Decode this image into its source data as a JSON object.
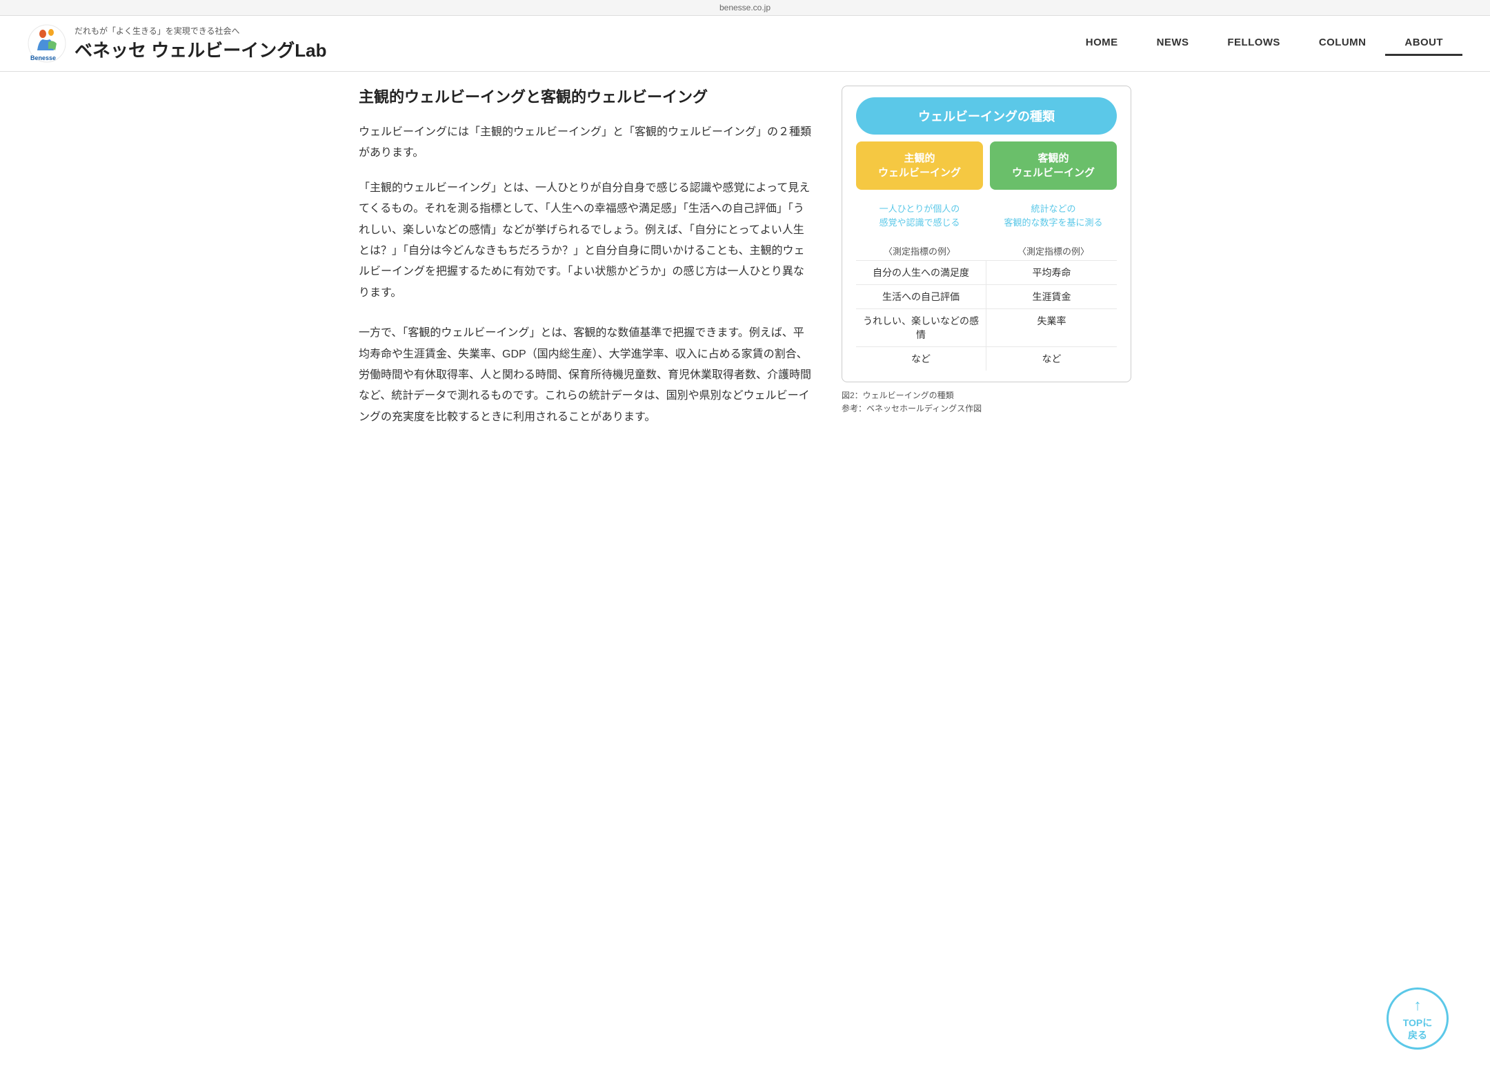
{
  "topbar": {
    "url": "benesse.co.jp"
  },
  "header": {
    "tagline": "だれもが「よく生きる」を実現できる社会へ",
    "title": "ベネッセ ウェルビーイングLab",
    "nav": [
      {
        "label": "HOME",
        "active": false
      },
      {
        "label": "NEWS",
        "active": false
      },
      {
        "label": "FELLOWS",
        "active": false
      },
      {
        "label": "COLUMN",
        "active": false
      },
      {
        "label": "ABOUT",
        "active": true
      }
    ]
  },
  "content": {
    "heading": "主観的ウェルビーイングと客観的ウェルビーイング",
    "paragraphs": [
      "ウェルビーイングには「主観的ウェルビーイング」と「客観的ウェルビーイング」の２種類があります。",
      "「主観的ウェルビーイング」とは、一人ひとりが自分自身で感じる認識や感覚によって見えてくるもの。それを測る指標として、「人生への幸福感や満足感」「生活への自己評価」「うれしい、楽しいなどの感情」などが挙げられるでしょう。例えば、「自分にとってよい人生とは？」「自分は今どんなきもちだろうか？」と自分自身に問いかけることも、主観的ウェルビーイングを把握するために有効です。「よい状態かどうか」の感じ方は一人ひとり異なります。",
      "一方で、「客観的ウェルビーイング」とは、客観的な数値基準で把握できます。例えば、平均寿命や生涯賃金、失業率、GDP（国内総生産）、大学進学率、収入に占める家賃の割合、労働時間や有休取得率、人と関わる時間、保育所待機児童数、育児休業取得者数、介護時間など、統計データで測れるものです。これらの統計データは、国別や県別などウェルビーイングの充実度を比較するときに利用されることがあります。"
    ]
  },
  "chart": {
    "title": "ウェルビーイングの種類",
    "col1": {
      "header": "主観的\nウェルビーイング",
      "description": "一人ひとりが個人の\n感覚や認識で感じる",
      "metrics_label": "〈測定指標の例〉",
      "metrics": [
        "自分の人生への満足度",
        "生活への自己評価",
        "うれしい、楽しいなどの感情",
        "など"
      ]
    },
    "col2": {
      "header": "客観的\nウェルビーイング",
      "description": "統計などの\n客観的な数字を基に測る",
      "metrics_label": "〈測定指標の例〉",
      "metrics": [
        "平均寿命",
        "生涯賃金",
        "失業率",
        "など"
      ]
    },
    "caption_line1": "図2：ウェルビーイングの種類",
    "caption_line2": "参考：ベネッセホールディングス作図"
  },
  "back_to_top": {
    "label": "TOPに\n戻る",
    "arrow": "↑"
  }
}
